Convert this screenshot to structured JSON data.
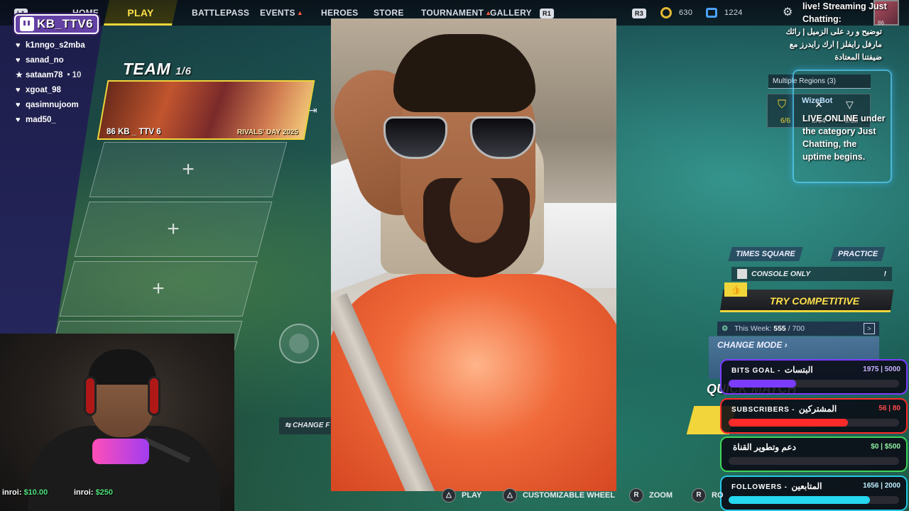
{
  "nav": {
    "l1": "L1",
    "home": "HOME",
    "play": "PLAY",
    "battlepass": "BATTLEPASS",
    "events": "EVENTS",
    "heroes": "HEROES",
    "store": "STORE",
    "tournament": "TOURNAMENT",
    "gallery": "GALLERY",
    "r1": "R1",
    "r3": "R3",
    "gold_currency": "630",
    "blue_currency": "1224"
  },
  "twitch": {
    "channel": "KB_TTV6",
    "chatters": [
      {
        "icon": "heart-icon",
        "name": "k1nngo_s2mba",
        "extra": ""
      },
      {
        "icon": "heart-icon",
        "name": "sanad_no",
        "extra": ""
      },
      {
        "icon": "star-icon",
        "name": "sataam78",
        "extra": "• 10"
      },
      {
        "icon": "heart-icon",
        "name": "xgoat_98",
        "extra": ""
      },
      {
        "icon": "heart-icon",
        "name": "qasimnujoom",
        "extra": ""
      },
      {
        "icon": "heart-icon",
        "name": "mad50_",
        "extra": ""
      }
    ]
  },
  "team": {
    "title": "TEAM",
    "count": "1/6",
    "card_name": "86 KB _ TTV 6",
    "card_event": "RIVALS' DAY 2025",
    "change_label": "CHANGE F"
  },
  "donations": {
    "d1_name": "inroi:",
    "d1_amount": "$10.00",
    "d2_name": "inroi:",
    "d2_amount": "$250"
  },
  "right": {
    "live_text": "live! Streaming Just Chatting:",
    "live_ar": "توضيح و رد على الزميل | رائك مارفل رايفلز | ارك رايدرز مع ضيفتنا المعتادة",
    "live_desc": "LIVE ONLINE under the category Just Chatting, the uptime begins.",
    "region": "Multiple Regions (3)",
    "bot": "WizeBot",
    "party_left": "6/6",
    "party_mid": "8/14",
    "party_right": "9/12",
    "avatar_level": "86",
    "times_square": "TIMES SQUARE",
    "practice": "PRACTICE",
    "console_only": "CONSOLE ONLY",
    "try_competitive": "TRY COMPETITIVE",
    "this_week_label": "This Week:",
    "this_week_value": "555",
    "this_week_total": "/ 700",
    "change_mode": "CHANGE MODE",
    "quick_match": "QUICK MATCH"
  },
  "goals": [
    {
      "label": "BITS GOAL -",
      "label_ar": "البتسات",
      "value": "1975 | 5000",
      "progress": 0.395,
      "border": "#7b3cff",
      "fill": "#7b3cff",
      "value_color": "#c8b2ff"
    },
    {
      "label": "SUBSCRIBERS -",
      "label_ar": "المشتركين",
      "value": "56 | 80",
      "progress": 0.7,
      "border": "#ff2a2a",
      "fill": "#ff2a2a",
      "value_color": "#ff4a4a"
    },
    {
      "label": "",
      "label_ar": "دعم وتطوير القناة",
      "value": "$0 | $500",
      "progress": 0.0,
      "border": "#3ed55a",
      "fill": "#3ed55a",
      "value_color": "#8ef0a0"
    },
    {
      "label": "FOLLOWERS -",
      "label_ar": "المتابعين",
      "value": "1656 | 2000",
      "progress": 0.828,
      "border": "#25c8e8",
      "fill": "#25d8f0",
      "value_color": "#bfefff"
    }
  ],
  "hints": {
    "play": "PLAY",
    "wheel": "CUSTOMIZABLE WHEEL",
    "zoom": "ZOOM",
    "ro": "RO"
  }
}
